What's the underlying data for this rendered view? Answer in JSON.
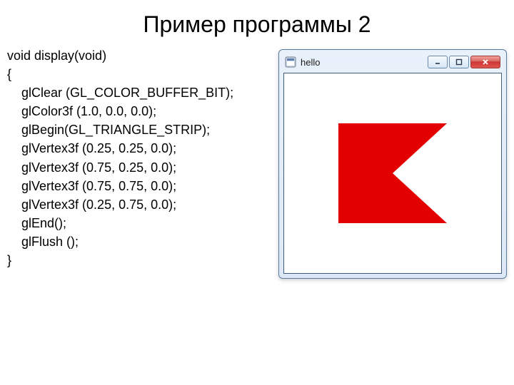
{
  "title": "Пример программы 2",
  "code": {
    "l0": "void display(void)",
    "l1": "{",
    "l2": "    glClear (GL_COLOR_BUFFER_BIT);",
    "l3": "    glColor3f (1.0, 0.0, 0.0);",
    "l4": "    glBegin(GL_TRIANGLE_STRIP);",
    "l5": "    glVertex3f (0.25, 0.25, 0.0);",
    "l6": "    glVertex3f (0.75, 0.25, 0.0);",
    "l7": "    glVertex3f (0.75, 0.75, 0.0);",
    "l8": "    glVertex3f (0.25, 0.75, 0.0);",
    "l9": "    glEnd();",
    "l10": "    glFlush ();",
    "l11": "}"
  },
  "window": {
    "title": "hello",
    "shape_color": "#e30000",
    "vertices_normalized": [
      [
        0.25,
        0.25
      ],
      [
        0.75,
        0.25
      ],
      [
        0.75,
        0.75
      ],
      [
        0.25,
        0.75
      ]
    ],
    "triangle_strip_triangles": [
      [
        [
          0.25,
          0.25
        ],
        [
          0.75,
          0.25
        ],
        [
          0.75,
          0.75
        ]
      ],
      [
        [
          0.75,
          0.25
        ],
        [
          0.75,
          0.75
        ],
        [
          0.25,
          0.75
        ]
      ]
    ]
  }
}
